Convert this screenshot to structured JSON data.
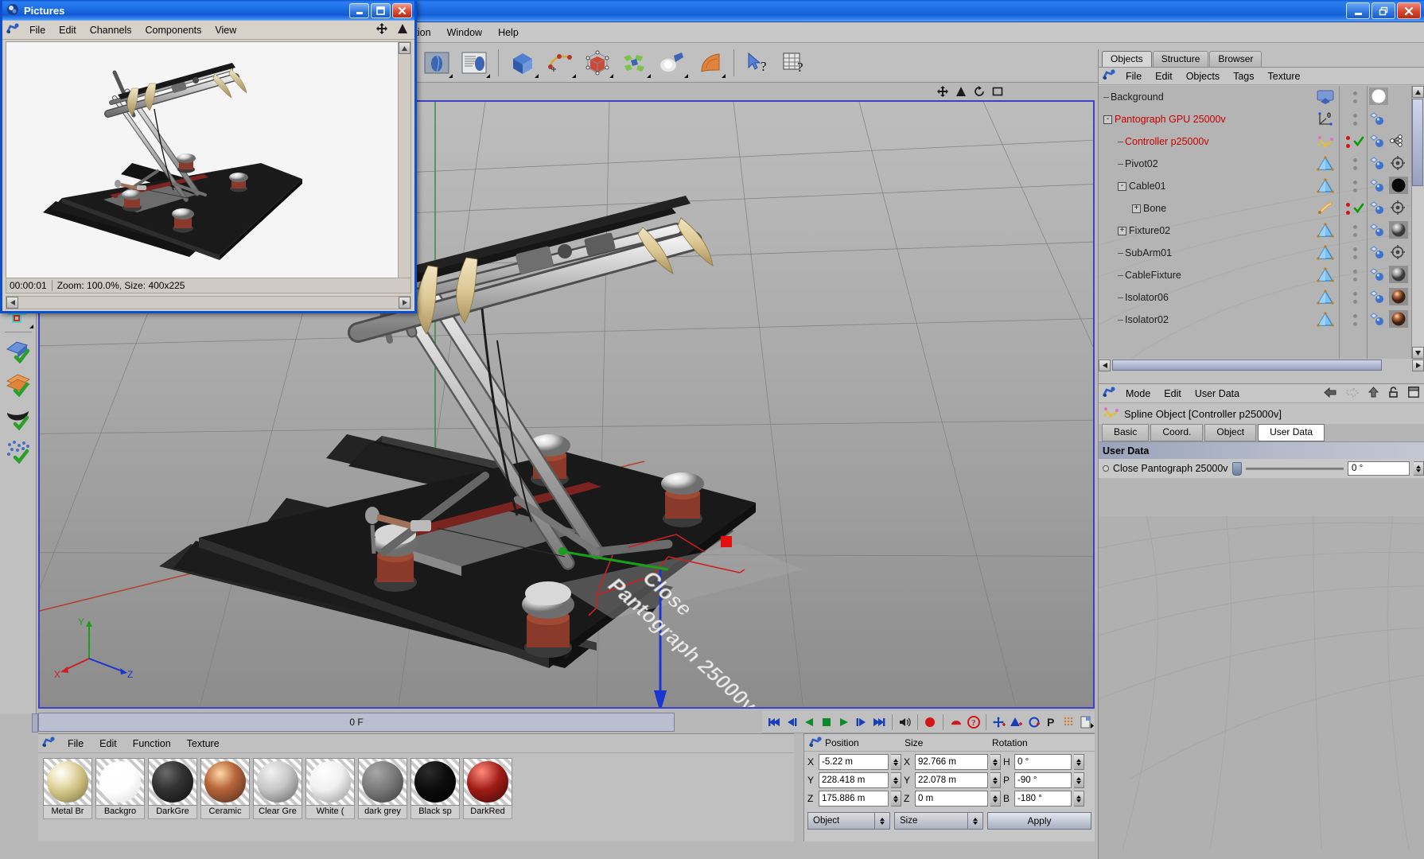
{
  "main_window": {
    "title": "",
    "window_buttons": [
      {
        "name": "minimize",
        "glyph": "–"
      },
      {
        "name": "restore",
        "glyph": "❐"
      },
      {
        "name": "close",
        "glyph": "✕"
      }
    ],
    "menu": [
      "Animation",
      "Window",
      "Help"
    ],
    "toolbar_icons": [
      "render-view-icon",
      "render-settings-icon",
      "primitive-cube-icon",
      "spline-icon",
      "hyper-nurbs-icon",
      "array-modeling-icon",
      "light-icon",
      "deformer-icon",
      "pick-help-icon",
      "table-help-icon"
    ],
    "left_toolbar_icons": [
      "selection-tools-icon",
      "checker-world-icon",
      "checker-axis-icon",
      "modeling-objects-icon",
      "move-tool-icon",
      "ik-chain-icon",
      "polygon-edit-icon",
      "enable-axis-icon",
      "enable-polygon-icon",
      "enable-surface-icon",
      "enable-points-icon"
    ]
  },
  "viewport": {
    "overlay_icons": [
      "move-view-icon",
      "scale-view-icon",
      "rotate-view-icon",
      "maximize-view-icon"
    ],
    "axis_labels": {
      "x": "X",
      "y": "Y",
      "z": "Z"
    },
    "scene_text": "Close Pantograph 25000v"
  },
  "timeline": {
    "frame_label": "0 F",
    "playback_buttons": [
      "go-to-start-icon",
      "step-back-keyframe-icon",
      "play-reverse-icon",
      "stop-icon",
      "play-icon",
      "step-forward-keyframe-icon",
      "go-to-end-icon",
      "sound-icon",
      "record-icon",
      "autokey-icon",
      "keyframe-help-icon",
      "record-position-icon",
      "record-scale-icon",
      "record-rotation-icon",
      "record-parameter-icon",
      "record-points-icon",
      "pla-icon"
    ]
  },
  "material_manager": {
    "menu": [
      "File",
      "Edit",
      "Function",
      "Texture"
    ],
    "materials": [
      {
        "label": "Metal Br",
        "color": "#d9cfa4",
        "preview": "earth"
      },
      {
        "label": "Backgro",
        "color": "#ffffff",
        "preview": "white"
      },
      {
        "label": "DarkGre",
        "color": "#2a2a2a",
        "preview": "dark"
      },
      {
        "label": "Ceramic",
        "color": "#8a5a3a",
        "preview": "ceramic"
      },
      {
        "label": "Clear Gre",
        "color": "#9a9a9a",
        "preview": "grey"
      },
      {
        "label": "White (",
        "color": "#ededed",
        "preview": "white2"
      },
      {
        "label": "dark grey",
        "color": "#6a6a6a",
        "preview": "dgrey"
      },
      {
        "label": "Black sp",
        "color": "#070707",
        "preview": "black"
      },
      {
        "label": "DarkRed",
        "color": "#8a1010",
        "preview": "red"
      }
    ]
  },
  "coordinate_manager": {
    "headers": {
      "position": "Position",
      "size": "Size",
      "rotation": "Rotation"
    },
    "position": {
      "x_label": "X",
      "x": "-5.22 m",
      "y_label": "Y",
      "y": "228.418 m",
      "z_label": "Z",
      "z": "175.886 m"
    },
    "size": {
      "x_label": "X",
      "x": "92.766 m",
      "y_label": "Y",
      "y": "22.078 m",
      "z_label": "Z",
      "z": "0 m"
    },
    "rotation": {
      "h_label": "H",
      "h": "0 °",
      "p_label": "P",
      "p": "-90 °",
      "b_label": "B",
      "b": "-180 °"
    },
    "mode_select": "Object",
    "size_select": "Size",
    "apply_button": "Apply"
  },
  "object_manager": {
    "tabs": [
      {
        "label": "Objects",
        "active": true
      },
      {
        "label": "Structure",
        "active": false
      },
      {
        "label": "Browser",
        "active": false
      }
    ],
    "menu": [
      "File",
      "Edit",
      "Objects",
      "Tags",
      "Texture"
    ],
    "tree": [
      {
        "name": "Background",
        "indent": 0,
        "expander": "",
        "red": false,
        "icon": "background-object-icon",
        "tags": [
          "texture-white-tag"
        ],
        "dots": 2,
        "check": false
      },
      {
        "name": "Pantograph GPU 25000v",
        "indent": 0,
        "expander": "-",
        "red": true,
        "icon": "null-object-icon",
        "tags": [
          "xpresso-tag"
        ],
        "dots": 2,
        "check": false
      },
      {
        "name": "Controller p25000v",
        "indent": 1,
        "expander": "",
        "red": true,
        "icon": "spline-object-icon",
        "tags": [
          "xpresso-tag",
          "hierarchy-tag"
        ],
        "dots": 2,
        "check": true
      },
      {
        "name": "Pivot02",
        "indent": 1,
        "expander": "",
        "red": false,
        "icon": "polygon-object-icon",
        "tags": [
          "xpresso-tag",
          "target-tag"
        ],
        "dots": 2,
        "check": false
      },
      {
        "name": "Cable01",
        "indent": 1,
        "expander": "-",
        "red": false,
        "icon": "polygon-object-icon",
        "tags": [
          "xpresso-tag",
          "texture-black-tag"
        ],
        "dots": 2,
        "check": false
      },
      {
        "name": "Bone",
        "indent": 2,
        "expander": "+",
        "red": false,
        "icon": "bone-object-icon",
        "tags": [
          "xpresso-tag",
          "target-tag"
        ],
        "dots": 2,
        "check": true
      },
      {
        "name": "Fixture02",
        "indent": 1,
        "expander": "+",
        "red": false,
        "icon": "polygon-object-icon",
        "tags": [
          "xpresso-tag",
          "texture-grey-tag"
        ],
        "dots": 2,
        "check": false
      },
      {
        "name": "SubArm01",
        "indent": 1,
        "expander": "",
        "red": false,
        "icon": "polygon-object-icon",
        "tags": [
          "xpresso-tag",
          "target-tag"
        ],
        "dots": 2,
        "check": false
      },
      {
        "name": "CableFixture",
        "indent": 1,
        "expander": "",
        "red": false,
        "icon": "polygon-object-icon",
        "tags": [
          "xpresso-tag",
          "texture-grey-tag"
        ],
        "dots": 2,
        "check": false
      },
      {
        "name": "Isolator06",
        "indent": 1,
        "expander": "",
        "red": false,
        "icon": "polygon-object-icon",
        "tags": [
          "xpresso-tag",
          "texture-copper-tag"
        ],
        "dots": 2,
        "check": false
      },
      {
        "name": "Isolator02",
        "indent": 1,
        "expander": "",
        "red": false,
        "icon": "polygon-object-icon",
        "tags": [
          "xpresso-tag",
          "texture-copper-tag"
        ],
        "dots": 2,
        "check": false
      }
    ]
  },
  "attribute_manager": {
    "menu": [
      "Mode",
      "Edit",
      "User Data"
    ],
    "toolbar_icons": [
      "back-arrow-icon",
      "forward-arrow-icon",
      "up-arrow-icon",
      "lock-icon",
      "layout-icon"
    ],
    "object_title": "Spline Object [Controller p25000v]",
    "tabs": [
      {
        "label": "Basic",
        "active": false
      },
      {
        "label": "Coord.",
        "active": false
      },
      {
        "label": "Object",
        "active": false
      },
      {
        "label": "User Data",
        "active": true
      }
    ],
    "section_title": "User Data",
    "param": {
      "label": "Close Pantograph 25000v",
      "value": "0 °"
    }
  },
  "pictures_window": {
    "title": "Pictures",
    "window_buttons": [
      {
        "name": "minimize",
        "glyph": "–"
      },
      {
        "name": "maximize",
        "glyph": "❐"
      },
      {
        "name": "close",
        "glyph": "✕"
      }
    ],
    "menu": [
      "File",
      "Edit",
      "Channels",
      "Components",
      "View"
    ],
    "toolbar_right_icons": [
      "pan-icon",
      "gamma-icon"
    ],
    "status": {
      "time": "00:00:01",
      "info": "Zoom: 100.0%, Size: 400x225"
    }
  },
  "colors": {
    "titlebar_blue": "#1a5ccc",
    "selected_red": "#c80000",
    "panel_grey": "#c0c0c0",
    "viewport_border": "#3f3fc8",
    "axis_x": "#cc2222",
    "axis_y": "#22aa22",
    "axis_z": "#2222cc"
  }
}
